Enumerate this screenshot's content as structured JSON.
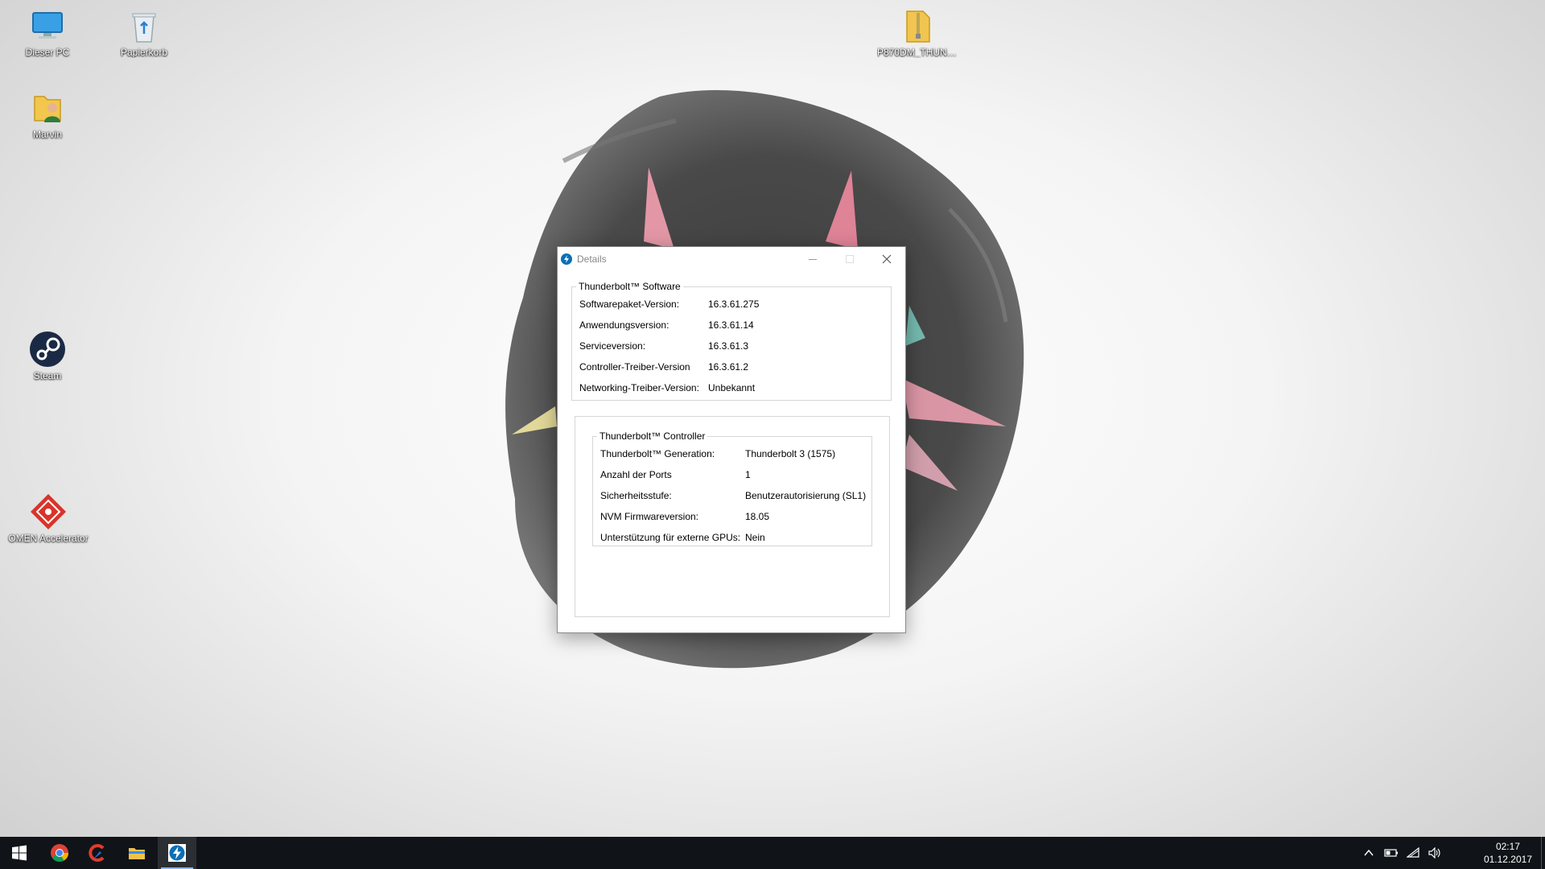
{
  "desktop": {
    "icons": [
      {
        "label": "Dieser PC"
      },
      {
        "label": "Papierkorb"
      },
      {
        "label": "P870DM_THUNDE..."
      },
      {
        "label": "Marvin"
      },
      {
        "label": "Steam"
      },
      {
        "label": "OMEN Accelerator"
      }
    ]
  },
  "dialog": {
    "title": "Details",
    "software": {
      "legend": "Thunderbolt™ Software",
      "rows": [
        {
          "key": "Softwarepaket-Version:",
          "value": "16.3.61.275"
        },
        {
          "key": "Anwendungsversion:",
          "value": "16.3.61.14"
        },
        {
          "key": "Serviceversion:",
          "value": "16.3.61.3"
        },
        {
          "key": "Controller-Treiber-Version",
          "value": "16.3.61.2"
        },
        {
          "key": "Networking-Treiber-Version:",
          "value": "Unbekannt"
        }
      ]
    },
    "controller": {
      "legend": "Thunderbolt™ Controller",
      "rows": [
        {
          "key": "Thunderbolt™ Generation:",
          "value": "Thunderbolt 3 (1575)"
        },
        {
          "key": "Anzahl der Ports",
          "value": "1"
        },
        {
          "key": "Sicherheitsstufe:",
          "value": "Benutzerautorisierung (SL1)"
        },
        {
          "key": "NVM Firmwareversion:",
          "value": "18.05"
        },
        {
          "key": "Unterstützung für externe GPUs:",
          "value": "Nein"
        }
      ]
    }
  },
  "taskbar": {
    "apps": [
      {
        "icon": "windows-start-icon"
      },
      {
        "icon": "chrome-icon"
      },
      {
        "icon": "ccleaner-icon"
      },
      {
        "icon": "file-explorer-icon"
      },
      {
        "icon": "thunderbolt-icon",
        "active": true
      }
    ],
    "tray_icons": [
      "chevron-up-icon",
      "battery-icon",
      "wifi-icon",
      "volume-icon"
    ],
    "time": "02:17",
    "date": "01.12.2017"
  },
  "colors": {
    "taskbar": "#101418",
    "dialog_border": "#8a8a8a",
    "group_border": "#d6d6d6",
    "thunderbolt_blue": "#0a6fb5"
  }
}
